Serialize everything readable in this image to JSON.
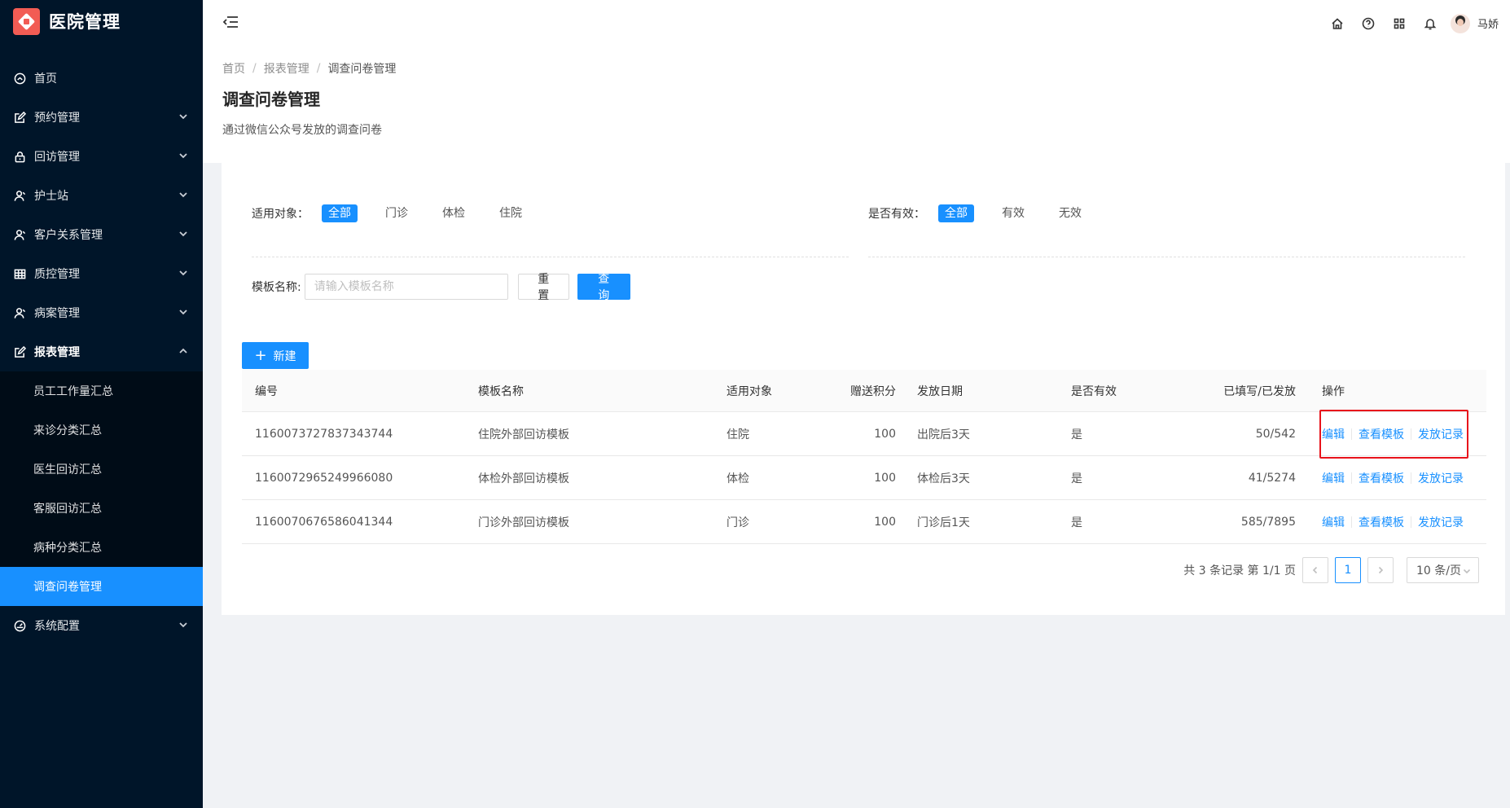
{
  "app": {
    "title": "医院管理"
  },
  "sidebar": {
    "items": [
      {
        "label": "首页",
        "icon": "dashboard-icon"
      },
      {
        "label": "预约管理",
        "icon": "form-icon"
      },
      {
        "label": "回访管理",
        "icon": "lock-icon"
      },
      {
        "label": "护士站",
        "icon": "user-icon"
      },
      {
        "label": "客户关系管理",
        "icon": "user-icon"
      },
      {
        "label": "质控管理",
        "icon": "table-icon"
      },
      {
        "label": "病案管理",
        "icon": "user-icon"
      },
      {
        "label": "报表管理",
        "icon": "form-icon"
      },
      {
        "label": "系统配置",
        "icon": "dashboard-icon"
      }
    ],
    "report_sub": [
      {
        "label": "员工工作量汇总"
      },
      {
        "label": "来诊分类汇总"
      },
      {
        "label": "医生回访汇总"
      },
      {
        "label": "客服回访汇总"
      },
      {
        "label": "病种分类汇总"
      },
      {
        "label": "调查问卷管理"
      }
    ]
  },
  "header": {
    "user_name": "马娇"
  },
  "breadcrumb": [
    "首页",
    "报表管理",
    "调查问卷管理"
  ],
  "page": {
    "title": "调查问卷管理",
    "description": "通过微信公众号发放的调查问卷"
  },
  "filters": {
    "target": {
      "label": "适用对象：",
      "options": [
        "全部",
        "门诊",
        "体检",
        "住院"
      ],
      "selected": "全部"
    },
    "valid": {
      "label": "是否有效：",
      "options": [
        "全部",
        "有效",
        "无效"
      ],
      "selected": "全部"
    }
  },
  "search": {
    "label": "模板名称:",
    "placeholder": "请输入模板名称",
    "value": "",
    "reset_label": "重 置",
    "query_label": "查 询"
  },
  "new_button": {
    "label": "新建"
  },
  "table": {
    "columns": [
      "编号",
      "模板名称",
      "适用对象",
      "赠送积分",
      "发放日期",
      "是否有效",
      "已填写/已发放",
      "操作"
    ],
    "rows": [
      {
        "id": "1160073727837343744",
        "name": "住院外部回访模板",
        "target": "住院",
        "points": "100",
        "date": "出院后3天",
        "valid": "是",
        "filled": "50/542"
      },
      {
        "id": "1160072965249966080",
        "name": "体检外部回访模板",
        "target": "体检",
        "points": "100",
        "date": "体检后3天",
        "valid": "是",
        "filled": "41/5274"
      },
      {
        "id": "1160070676586041344",
        "name": "门诊外部回访模板",
        "target": "门诊",
        "points": "100",
        "date": "门诊后1天",
        "valid": "是",
        "filled": "585/7895"
      }
    ],
    "actions": {
      "edit": "编辑",
      "view": "查看模板",
      "records": "发放记录"
    }
  },
  "pagination": {
    "summary": "共 3 条记录 第 1/1 页",
    "current_page": "1",
    "page_size": "10 条/页"
  },
  "colors": {
    "sidebar_bg": "#001529",
    "primary": "#1890ff",
    "highlight_box": "#e8131b",
    "logo": "#f25c54"
  }
}
